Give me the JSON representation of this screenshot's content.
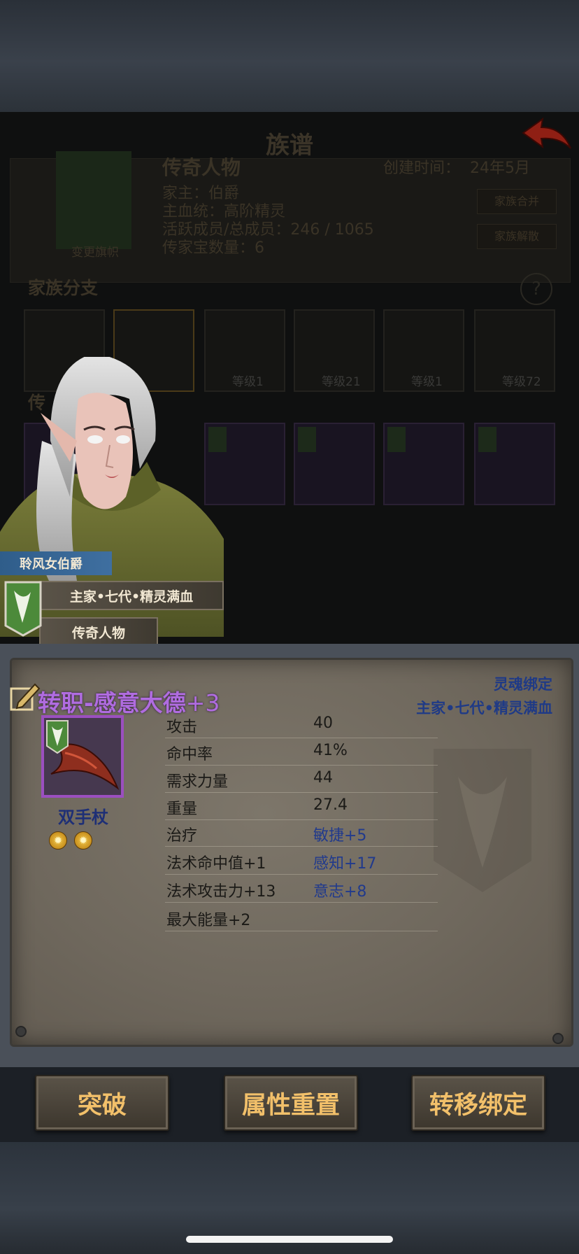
{
  "background": {
    "title": "族谱",
    "family_name": "传奇人物",
    "created_label": "创建时间：",
    "created_value": "24年5月",
    "head_line": "家主：伯爵",
    "bloodline_line": "主血统：高阶精灵",
    "members_line": "活跃成员/总成员：246 / 1065",
    "heirloom_line": "传家宝数量：6",
    "banner_label": "变更旗帜",
    "merge_button": "家族合并",
    "disband_button": "家族解散",
    "branch_title": "家族分支",
    "legend_title": "传",
    "branch_levels": [
      "等级1",
      "等级21",
      "等级1",
      "等级72"
    ]
  },
  "character": {
    "title": "聆风女伯爵",
    "lineage": "主家•七代•精灵满血",
    "rank": "传奇人物"
  },
  "item": {
    "title_main": "转职-感意大德",
    "title_plus": "+3",
    "binding": "灵魂绑定",
    "bloodline": "主家•七代•精灵满血",
    "type": "双手杖",
    "stars": 2,
    "stats": [
      {
        "name": "攻击",
        "value": "40"
      },
      {
        "name": "命中率",
        "value": "41%"
      },
      {
        "name": "需求力量",
        "value": "44"
      },
      {
        "name": "重量",
        "value": "27.4"
      },
      {
        "name": "治疗",
        "value": "敏捷+5"
      },
      {
        "name": "法术命中值+1",
        "value": "感知+17"
      },
      {
        "name": "法术攻击力+13",
        "value": "意志+8"
      },
      {
        "name": "最大能量+2",
        "value": ""
      }
    ]
  },
  "buttons": {
    "breakthrough": "突破",
    "reset": "属性重置",
    "transfer": "转移绑定"
  },
  "colors": {
    "item_title": "#b06ce0",
    "bonus_text": "#213a8c",
    "button_text": "#f2c06a"
  }
}
